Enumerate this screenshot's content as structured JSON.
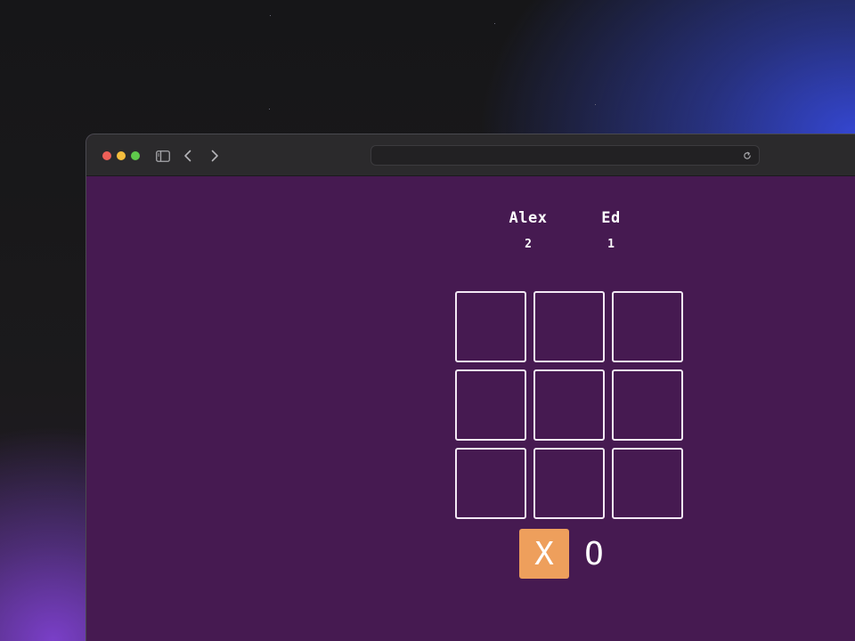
{
  "game": {
    "players": [
      {
        "name": "Alex",
        "score": "2"
      },
      {
        "name": "Ed",
        "score": "1"
      }
    ],
    "board": [
      "",
      "",
      "",
      "",
      "",
      "",
      "",
      "",
      ""
    ],
    "marks": {
      "x_label": "X",
      "o_label": "O",
      "selected": "X"
    }
  },
  "colors": {
    "page_background": "#461a51",
    "selected_mark": "#ee9f5c",
    "cell_border": "#f2e8f4",
    "toolbar": "#2b2a2c"
  },
  "icons": {
    "toolbar": [
      "sidebar-icon",
      "chevron-left-icon",
      "chevron-right-icon"
    ],
    "address_bar": [
      "reload-icon"
    ]
  }
}
